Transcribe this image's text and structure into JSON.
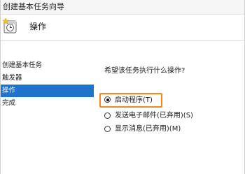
{
  "window": {
    "title": "创建基本任务向导"
  },
  "header": {
    "heading": "操作",
    "icon": "task-scheduler-icon"
  },
  "sidebar": {
    "items": [
      {
        "label": "创建基本任务",
        "active": false
      },
      {
        "label": "触发器",
        "active": false
      },
      {
        "label": "操作",
        "active": true
      },
      {
        "label": "完成",
        "active": false
      }
    ]
  },
  "main": {
    "question": "希望该任务执行什么操作?",
    "options": [
      {
        "label": "启动程序(T)",
        "checked": true
      },
      {
        "label": "发送电子邮件(已弃用)(S)",
        "checked": false
      },
      {
        "label": "显示消息(已弃用)(M)",
        "checked": false
      }
    ]
  },
  "colors": {
    "accent": "#1f73c9",
    "highlight": "#f08a1c"
  }
}
